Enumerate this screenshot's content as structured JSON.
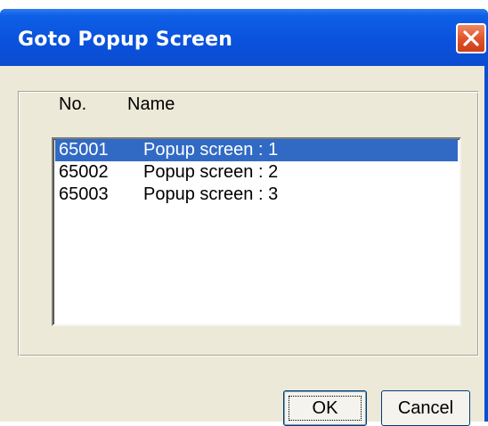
{
  "window": {
    "title": "Goto  Popup Screen",
    "close_icon": "close-x-icon",
    "accent_color": "#0a52dd"
  },
  "list": {
    "headers": {
      "no": "No.",
      "name": "Name"
    },
    "items": [
      {
        "no": "65001",
        "name": "Popup screen : 1",
        "selected": true
      },
      {
        "no": "65002",
        "name": "Popup screen : 2",
        "selected": false
      },
      {
        "no": "65003",
        "name": "Popup screen : 3",
        "selected": false
      }
    ],
    "selection_color": "#316ac5"
  },
  "buttons": {
    "ok_label": "OK",
    "cancel_label": "Cancel"
  }
}
